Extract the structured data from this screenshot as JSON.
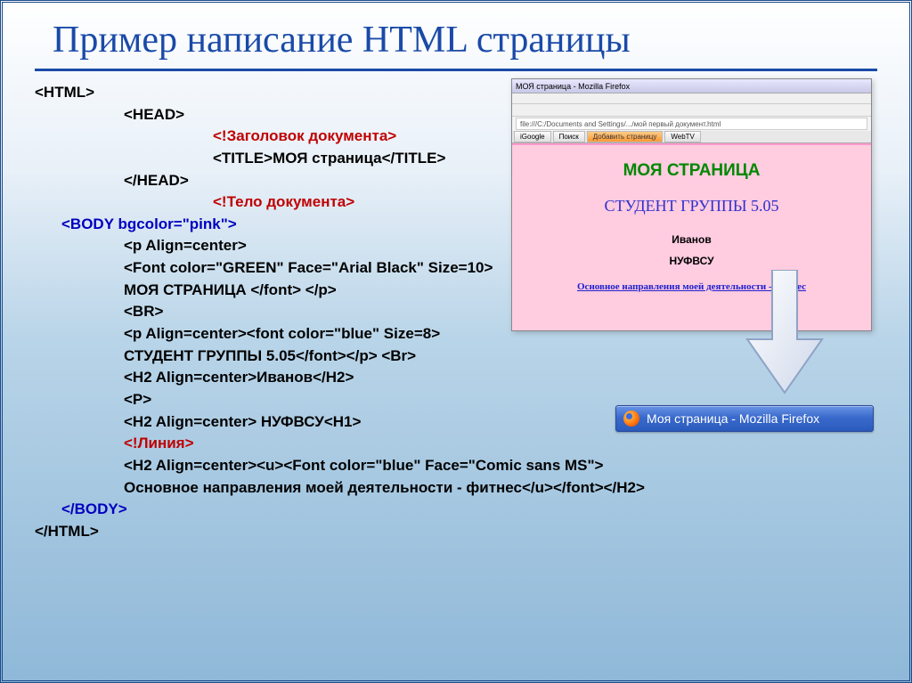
{
  "title": "Пример написание HTML страницы",
  "code": {
    "l1": "<HTML>",
    "l2": "<HEAD>",
    "l3": "<!Заголовок документа>",
    "l4": "<TITLE>МОЯ страница</TITLE>",
    "l5": "</HEAD>",
    "l6": "<!Тело документа>",
    "l7": "<BODY bgcolor=\"pink\">",
    "l8": "<p Align=center>",
    "l9": "<Font color=\"GREEN\" Face=\"Arial Black\" Size=10>",
    "l10": "МОЯ СТРАНИЦА </font> </p>",
    "l11": "<BR>",
    "l12": "<p Align=center><font color=\"blue\" Size=8>",
    "l13": "СТУДЕНТ ГРУППЫ 5.05</font></p> <Br>",
    "l14": "<H2 Align=center>Иванов</H2>",
    "l15": "<P>",
    "l16": "<H2 Align=center> НУФВСУ<H1>",
    "l17": "<!Линия>",
    "l18": "<H2 Align=center><u><Font color=\"blue\" Face=\"Comic sans MS\">",
    "l19": "Основное направления моей деятельности - фитнес</u></font></H2>",
    "l20": "</BODY>",
    "l21": "</HTML>"
  },
  "preview": {
    "titlebar": "МОЯ страница - Mozilla Firefox",
    "address": "file:///C:/Documents and Settings/.../мой первый документ.html",
    "tab1": "iGoogle",
    "tab2": "Поиск",
    "tab3": "Добавить страницу",
    "tab4": "WebTV",
    "heading1": "МОЯ СТРАНИЦА",
    "heading2": "СТУДЕНТ ГРУППЫ 5.05",
    "name": "Иванов",
    "org": "НУФВСУ",
    "link": "Основное направления моей деятельности -  фитнес"
  },
  "taskbar": {
    "label": "Моя страница - Mozilla Firefox"
  }
}
